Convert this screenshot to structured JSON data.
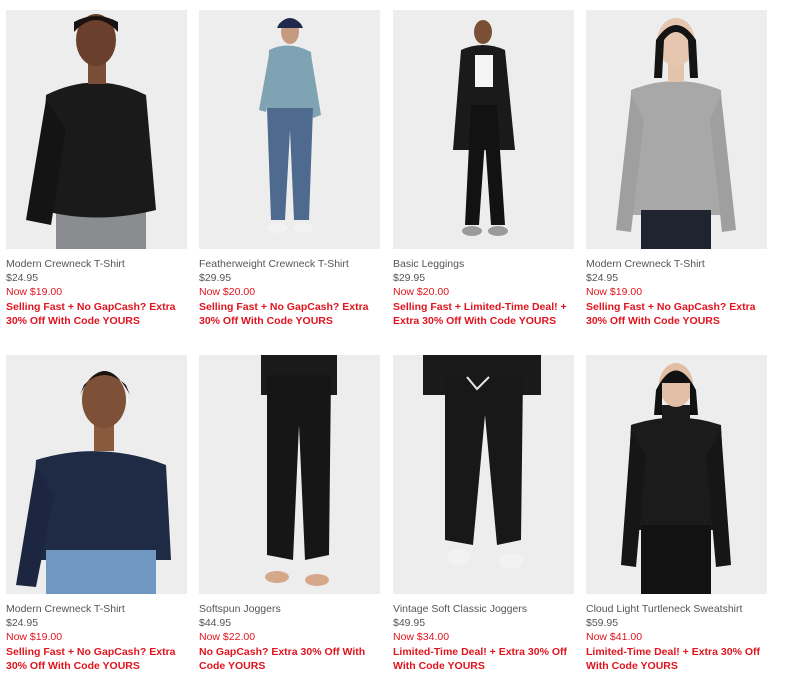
{
  "products": [
    {
      "name": "Modern Crewneck T-Shirt",
      "price": "$24.95",
      "sale": "Now $19.00",
      "promo": "Selling Fast + No GapCash? Extra 30% Off With Code YOURS"
    },
    {
      "name": "Featherweight Crewneck T-Shirt",
      "price": "$29.95",
      "sale": "Now $20.00",
      "promo": "Selling Fast + No GapCash? Extra 30% Off With Code YOURS"
    },
    {
      "name": "Basic Leggings",
      "price": "$29.95",
      "sale": "Now $20.00",
      "promo": "Selling Fast + Limited-Time Deal! + Extra 30% Off With Code YOURS"
    },
    {
      "name": "Modern Crewneck T-Shirt",
      "price": "$24.95",
      "sale": "Now $19.00",
      "promo": "Selling Fast + No GapCash? Extra 30% Off With Code YOURS"
    },
    {
      "name": "Modern Crewneck T-Shirt",
      "price": "$24.95",
      "sale": "Now $19.00",
      "promo": "Selling Fast + No GapCash? Extra 30% Off With Code YOURS"
    },
    {
      "name": "Softspun Joggers",
      "price": "$44.95",
      "sale": "Now $22.00",
      "promo": "No GapCash? Extra 30% Off With Code YOURS"
    },
    {
      "name": "Vintage Soft Classic Joggers",
      "price": "$49.95",
      "sale": "Now $34.00",
      "promo": "Limited-Time Deal! + Extra 30% Off With Code YOURS"
    },
    {
      "name": "Cloud Light Turtleneck Sweatshirt",
      "price": "$59.95",
      "sale": "Now $41.00",
      "promo": "Limited-Time Deal! + Extra 30% Off With Code YOURS"
    }
  ],
  "colors": {
    "sale_red": "#e0141e",
    "text_gray": "#555555",
    "photo_bg": "#ececec"
  }
}
